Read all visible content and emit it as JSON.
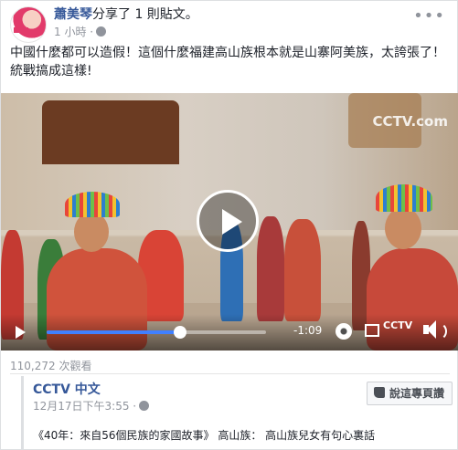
{
  "post": {
    "poster_name": "蕭美琴",
    "action_text": "分享了 1 則貼文。",
    "timestamp": "1 小時 ·",
    "text": "中國什麼都可以造假！這個什麼福建高山族根本就是山寨阿美族，太誇張了！ 統戰搞成這樣!",
    "options_icon": "more-options-icon"
  },
  "video": {
    "watermark": "CCTV.com",
    "time_remaining": "-1:09",
    "progress": 0.61,
    "logo_text": "CCTV",
    "icons": [
      "play-icon",
      "settings-gear-icon",
      "fullscreen-icon",
      "volume-icon"
    ]
  },
  "views": "110,272 次觀看",
  "attachment": {
    "source_name": "CCTV 中文",
    "source_time": "12月17日下午3:55 ·",
    "follow_label": "說這專頁讚",
    "description": "《40年：來自56個民族的家國故事》 高山族： 高山族兒女有句心裏話"
  },
  "colors": {
    "link": "#365899",
    "progress": "#4080ff",
    "meta": "#90949c"
  }
}
